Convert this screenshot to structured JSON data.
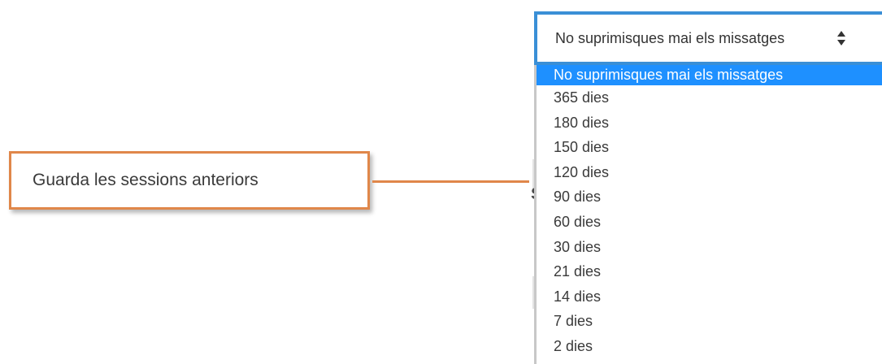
{
  "callout": {
    "text": "Guarda les sessions anteriors"
  },
  "select": {
    "value": "No suprimisques mai els missatges"
  },
  "dropdown": {
    "options": [
      "No suprimisques mai els missatges",
      "365 dies",
      "180 dies",
      "150 dies",
      "120 dies",
      "90 dies",
      "60 dies",
      "30 dies",
      "21 dies",
      "14 dies",
      "7 dies",
      "2 dies"
    ],
    "selected_index": 0
  },
  "background": {
    "partial_heading_glyph": "S"
  },
  "colors": {
    "callout_border": "#e0874a",
    "select_border": "#3a8fd6",
    "highlight": "#1e90ff"
  },
  "icons": {
    "select_arrows": "up-down-caret-icon"
  }
}
